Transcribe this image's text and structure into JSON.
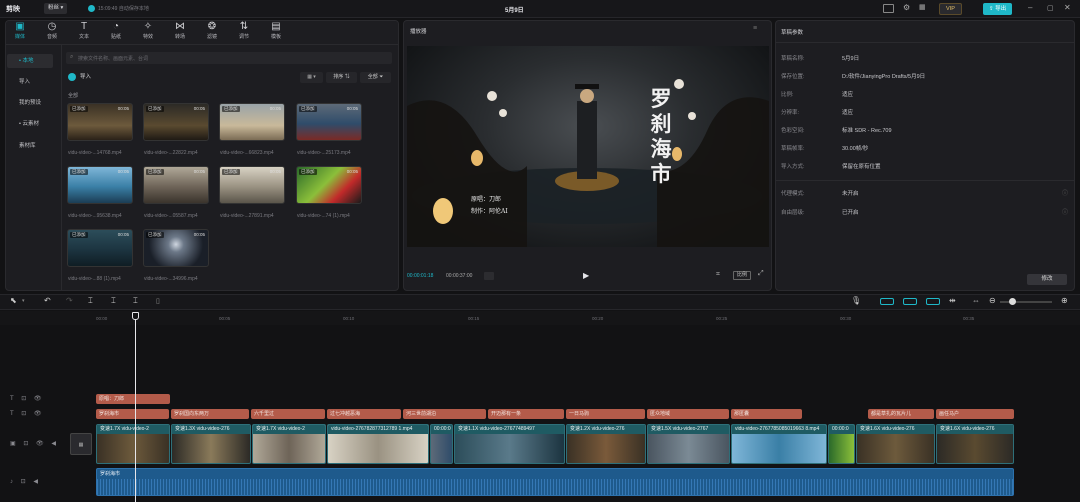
{
  "app": {
    "logo": "剪映",
    "account_label": "粉丝",
    "autosave": "15:09:49 自动保存本地",
    "title": "5月9日",
    "vip": "VIP",
    "export": "导出"
  },
  "toolbar": {
    "items": [
      "媒体",
      "音频",
      "文本",
      "贴纸",
      "特效",
      "转场",
      "滤镜",
      "调节",
      "模板"
    ]
  },
  "sidebar": {
    "items": [
      "• 本地",
      "导入",
      "我的预设",
      "• 云素材",
      "素材库"
    ]
  },
  "media": {
    "search_placeholder": "搜索文件名称、画面元素、台词",
    "import_label": "导入",
    "sort_label": "排序",
    "filter_label": "全部",
    "section_label": "全部",
    "badge": "已添加",
    "clips": [
      {
        "name": "vidu-video-...14768.mp4",
        "dur": "00:05"
      },
      {
        "name": "vidu-video-...22822.mp4",
        "dur": "00:05"
      },
      {
        "name": "vidu-video-...66823.mp4",
        "dur": "00:05"
      },
      {
        "name": "vidu-video-...25173.mp4",
        "dur": "00:05"
      },
      {
        "name": "vidu-video-...95638.mp4",
        "dur": "00:05"
      },
      {
        "name": "vidu-video-...05587.mp4",
        "dur": "00:05"
      },
      {
        "name": "vidu-video-...27891.mp4",
        "dur": "00:05"
      },
      {
        "name": "vidu-video-...74 (1).mp4",
        "dur": "00:05"
      },
      {
        "name": "vidu-video-...88 (1).mp4",
        "dur": "00:05"
      },
      {
        "name": "vidu-video-...34996.mp4",
        "dur": "00:05"
      }
    ]
  },
  "player": {
    "title": "播放器",
    "current_time": "00:00:01:18",
    "total_time": "00:00:37:00",
    "ratio_label": "比例",
    "poster_title": "罗刹海市",
    "credit_line1": "原唱：刀郎",
    "credit_line2": "制作：阿伦AI"
  },
  "draft": {
    "title": "草稿参数",
    "rows": [
      {
        "label": "草稿名称:",
        "value": "5月9日"
      },
      {
        "label": "保存位置:",
        "value": "D:/软件/JianyingPro Drafts/5月9日"
      },
      {
        "label": "比例:",
        "value": "适应"
      },
      {
        "label": "分辨率:",
        "value": "适应"
      },
      {
        "label": "色彩空间:",
        "value": "标准 SDR - Rec.709"
      },
      {
        "label": "草稿帧率:",
        "value": "30.00帧/秒"
      },
      {
        "label": "导入方式:",
        "value": "保留在原有位置"
      }
    ],
    "rows2": [
      {
        "label": "代理模式:",
        "value": "未开启"
      },
      {
        "label": "自由层级:",
        "value": "已开启"
      }
    ],
    "edit_button": "修改"
  },
  "timeline": {
    "ticks": [
      "00:00",
      "00:05",
      "00:10",
      "00:15",
      "00:20",
      "00:25",
      "00:30",
      "00:35"
    ],
    "playhead_fraction": 0.061,
    "text_track1": [
      {
        "label": "原唱：刀郎"
      }
    ],
    "text_track2": [
      "罗刹海市",
      "罗刹国向东两万",
      "六千里过",
      "过七冲越恶海",
      "河三世前湖泊",
      "开迈那有一条",
      "一日马驹",
      "匿众地域",
      "那匿囊",
      "都是草扎的瓦片儿",
      "画任马户"
    ],
    "video_clips": [
      "变速1.7X vidu-video-2",
      "变速1.3X vidu-video-276",
      "变速1.7X vidu-video-2",
      "vidu-video-276782877312789 1.mp4",
      "00:00:0",
      "变速1.1X vidu-video-27677489497",
      "变速1.2X vidu-video-276",
      "变速1.5X vidu-video-2767",
      "vidu-video-2767785085019663 8.mp4",
      "00:00:0",
      "变速1.6X vidu-video-276",
      "变速1.6X vidu-video-276"
    ],
    "audio_label": "罗刹海市"
  },
  "colors": {
    "accent": "#1fb8c8",
    "text_clip": "#b35b4a",
    "video_clip": "#1f5b63",
    "audio_clip": "#1e5a8c"
  }
}
